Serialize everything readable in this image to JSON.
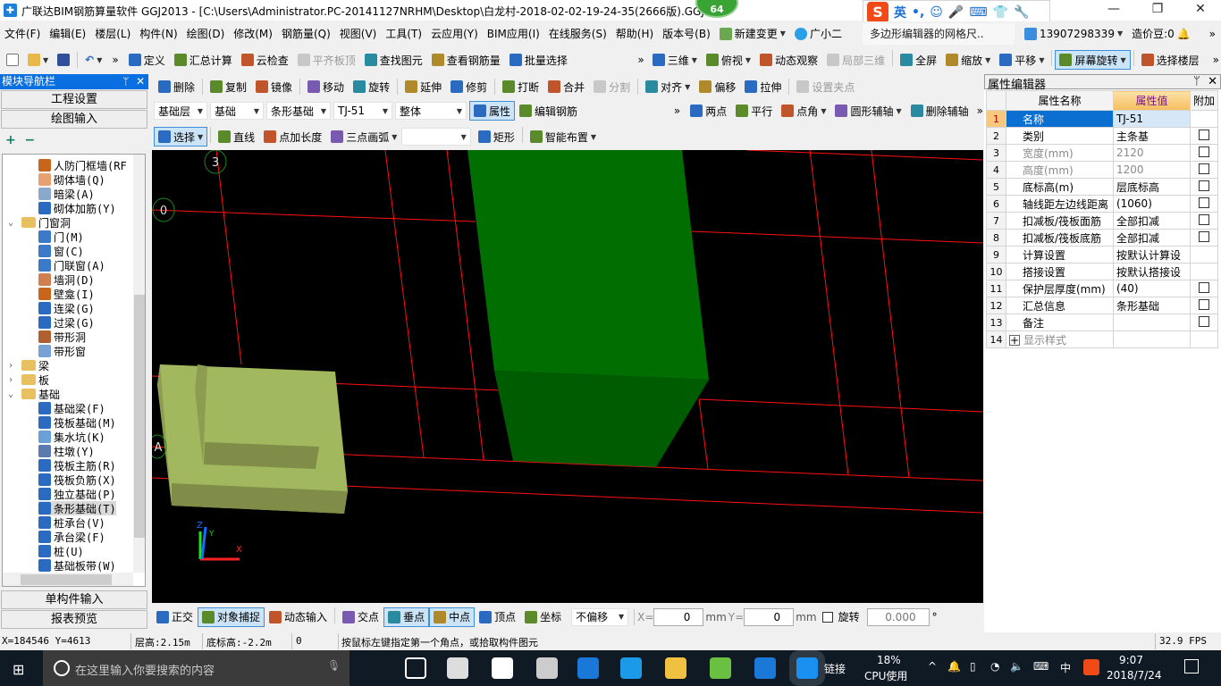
{
  "title_bar": {
    "title": "广联达BIM钢筋算量软件 GGJ2013 - [C:\\Users\\Administrator.PC-20141127NRHM\\Desktop\\白龙村-2018-02-02-19-24-35(2666版).GGJ12",
    "badge": "64",
    "minimize": "—",
    "restore": "❐",
    "close": "✕"
  },
  "ime": {
    "logo": "S",
    "lang": "英",
    "punct": "•,",
    "emoji": "☺",
    "mic": "🎤",
    "keyboard": "⌨",
    "skin": "👕",
    "settings": "🔧"
  },
  "menu": {
    "items": [
      "文件(F)",
      "编辑(E)",
      "楼层(L)",
      "构件(N)",
      "绘图(D)",
      "修改(M)",
      "钢筋量(Q)",
      "视图(V)",
      "工具(T)",
      "云应用(Y)",
      "BIM应用(I)",
      "在线服务(S)",
      "帮助(H)",
      "版本号(B)"
    ],
    "new_change": "新建变更",
    "assistant": "广小二",
    "notice": "多边形编辑器的网格尺..",
    "account": "13907298339",
    "beans": "造价豆:0",
    "more": "»"
  },
  "toolbar1": {
    "more": "»",
    "left": [
      {
        "label": "定义",
        "icon": "define-icon",
        "state": ""
      },
      {
        "label": "汇总计算",
        "icon": "sigma-icon",
        "state": ""
      },
      {
        "label": "云检查",
        "icon": "cloud-check-icon",
        "state": ""
      },
      {
        "label": "平齐板顶",
        "icon": "align-slab-top-icon",
        "state": "dis"
      },
      {
        "label": "查找图元",
        "icon": "binoculars-icon",
        "state": ""
      },
      {
        "label": "查看钢筋量",
        "icon": "view-rebar-icon",
        "state": ""
      },
      {
        "label": "批量选择",
        "icon": "batch-select-icon",
        "state": ""
      }
    ],
    "right": [
      {
        "label": "三维",
        "icon": "cube-3d-icon",
        "state": "",
        "dd": true
      },
      {
        "label": "俯视",
        "icon": "top-view-icon",
        "state": "",
        "dd": true
      },
      {
        "label": "动态观察",
        "icon": "orbit-icon",
        "state": ""
      },
      {
        "label": "局部三维",
        "icon": "local-3d-icon",
        "state": "dis"
      },
      {
        "label": "全屏",
        "icon": "fullscreen-icon",
        "state": ""
      },
      {
        "label": "缩放",
        "icon": "zoom-icon",
        "state": "",
        "dd": true
      },
      {
        "label": "平移",
        "icon": "pan-hand-icon",
        "state": "",
        "dd": true
      },
      {
        "label": "屏幕旋转",
        "icon": "screen-rotate-icon",
        "state": "act",
        "dd": true
      },
      {
        "label": "选择楼层",
        "icon": "select-floor-icon",
        "state": ""
      }
    ]
  },
  "toolbar2": [
    {
      "label": "删除",
      "icon": "delete-icon",
      "state": ""
    },
    {
      "label": "复制",
      "icon": "copy-icon",
      "state": ""
    },
    {
      "label": "镜像",
      "icon": "mirror-icon",
      "state": ""
    },
    {
      "label": "移动",
      "icon": "move-icon",
      "state": ""
    },
    {
      "label": "旋转",
      "icon": "rotate-icon",
      "state": ""
    },
    {
      "label": "延伸",
      "icon": "extend-icon",
      "state": ""
    },
    {
      "label": "修剪",
      "icon": "trim-icon",
      "state": ""
    },
    {
      "label": "打断",
      "icon": "break-icon",
      "state": ""
    },
    {
      "label": "合并",
      "icon": "merge-icon",
      "state": ""
    },
    {
      "label": "分割",
      "icon": "split-icon",
      "state": "dis"
    },
    {
      "label": "对齐",
      "icon": "align-icon",
      "state": "",
      "dd": true
    },
    {
      "label": "偏移",
      "icon": "offset-icon",
      "state": ""
    },
    {
      "label": "拉伸",
      "icon": "stretch-icon",
      "state": ""
    },
    {
      "label": "设置夹点",
      "icon": "grip-icon",
      "state": "dis"
    }
  ],
  "toolbar3": {
    "selects": [
      "基础层",
      "基础",
      "条形基础",
      "TJ-51",
      "整体"
    ],
    "buttons": [
      {
        "label": "属性",
        "icon": "properties-icon",
        "state": "act"
      },
      {
        "label": "编辑钢筋",
        "icon": "edit-rebar-icon",
        "state": ""
      }
    ],
    "more": "»",
    "axis": [
      {
        "label": "两点",
        "icon": "two-point-axis-icon",
        "state": ""
      },
      {
        "label": "平行",
        "icon": "parallel-axis-icon",
        "state": ""
      },
      {
        "label": "点角",
        "icon": "point-angle-axis-icon",
        "state": "",
        "dd": true
      },
      {
        "label": "圆形辅轴",
        "icon": "circular-axis-icon",
        "state": "",
        "dd": true
      },
      {
        "label": "删除辅轴",
        "icon": "delete-axis-icon",
        "state": ""
      }
    ]
  },
  "toolbar4": {
    "items": [
      {
        "label": "选择",
        "icon": "pointer-icon",
        "state": "act",
        "dd": true
      },
      {
        "label": "直线",
        "icon": "line-icon",
        "state": ""
      },
      {
        "label": "点加长度",
        "icon": "point-length-icon",
        "state": ""
      },
      {
        "label": "三点画弧",
        "icon": "arc-icon",
        "state": "",
        "dd": true
      }
    ],
    "shape_select": "",
    "items2": [
      {
        "label": "矩形",
        "icon": "rectangle-icon",
        "state": ""
      },
      {
        "label": "智能布置",
        "icon": "smart-layout-icon",
        "state": "",
        "dd": true
      }
    ]
  },
  "nav": {
    "title": "模块导航栏",
    "pin": "ᛘ",
    "close": "✕",
    "top_buttons": [
      "工程设置",
      "绘图输入"
    ],
    "expand_icon": "+",
    "collapse_icon": "−",
    "tree": [
      {
        "label": "人防门框墙(RF",
        "level": 2,
        "icon": "civil-defense-wall-icon",
        "color": "#c8651b"
      },
      {
        "label": "砌体墙(Q)",
        "level": 2,
        "icon": "masonry-wall-icon",
        "color": "#e8a070"
      },
      {
        "label": "暗梁(A)",
        "level": 2,
        "icon": "hidden-beam-icon",
        "color": "#8aa8cc"
      },
      {
        "label": "砌体加筋(Y)",
        "level": 2,
        "icon": "masonry-rebar-icon",
        "color": "#2a6ac0"
      },
      {
        "label": "门窗洞",
        "level": 1,
        "icon": "folder-open-icon",
        "color": "#e8c060",
        "expanded": true
      },
      {
        "label": "门(M)",
        "level": 2,
        "icon": "door-icon",
        "color": "#3a78c8"
      },
      {
        "label": "窗(C)",
        "level": 2,
        "icon": "window-icon",
        "color": "#3a78c8"
      },
      {
        "label": "门联窗(A)",
        "level": 2,
        "icon": "door-window-icon",
        "color": "#3a78c8"
      },
      {
        "label": "墙洞(D)",
        "level": 2,
        "icon": "wall-hole-icon",
        "color": "#d08050"
      },
      {
        "label": "壁龛(I)",
        "level": 2,
        "icon": "niche-icon",
        "color": "#c8651b"
      },
      {
        "label": "连梁(G)",
        "level": 2,
        "icon": "coupling-beam-icon",
        "color": "#2a6ac0"
      },
      {
        "label": "过梁(G)",
        "level": 2,
        "icon": "lintel-icon",
        "color": "#2a6ac0"
      },
      {
        "label": "带形洞",
        "level": 2,
        "icon": "strip-hole-icon",
        "color": "#b06030"
      },
      {
        "label": "带形窗",
        "level": 2,
        "icon": "strip-window-icon",
        "color": "#7aa0d8"
      },
      {
        "label": "梁",
        "level": 1,
        "icon": "folder-icon",
        "color": "#e8c060",
        "expanded": false
      },
      {
        "label": "板",
        "level": 1,
        "icon": "folder-icon",
        "color": "#e8c060",
        "expanded": false
      },
      {
        "label": "基础",
        "level": 1,
        "icon": "folder-open-icon",
        "color": "#e8c060",
        "expanded": true
      },
      {
        "label": "基础梁(F)",
        "level": 2,
        "icon": "foundation-beam-icon",
        "color": "#2a6ac0"
      },
      {
        "label": "筏板基础(M)",
        "level": 2,
        "icon": "raft-foundation-icon",
        "color": "#2a6ac0"
      },
      {
        "label": "集水坑(K)",
        "level": 2,
        "icon": "sump-pit-icon",
        "color": "#6aa0d8"
      },
      {
        "label": "柱墩(Y)",
        "level": 2,
        "icon": "column-pier-icon",
        "color": "#5a7ab0"
      },
      {
        "label": "筏板主筋(R)",
        "level": 2,
        "icon": "raft-main-rebar-icon",
        "color": "#2a6ac0"
      },
      {
        "label": "筏板负筋(X)",
        "level": 2,
        "icon": "raft-neg-rebar-icon",
        "color": "#2a6ac0"
      },
      {
        "label": "独立基础(P)",
        "level": 2,
        "icon": "isolated-foundation-icon",
        "color": "#2a6ac0"
      },
      {
        "label": "条形基础(T)",
        "level": 2,
        "icon": "strip-foundation-icon",
        "color": "#2a6ac0",
        "selected": true
      },
      {
        "label": "桩承台(V)",
        "level": 2,
        "icon": "pile-cap-icon",
        "color": "#2a6ac0"
      },
      {
        "label": "承台梁(F)",
        "level": 2,
        "icon": "cap-beam-icon",
        "color": "#2a6ac0"
      },
      {
        "label": "桩(U)",
        "level": 2,
        "icon": "pile-icon",
        "color": "#2a6ac0"
      },
      {
        "label": "基础板带(W)",
        "level": 2,
        "icon": "foundation-strip-icon",
        "color": "#2a6ac0"
      }
    ],
    "bottom_buttons": [
      "单构件输入",
      "报表预览"
    ]
  },
  "viewport": {
    "axis_labels": [
      "3",
      "0",
      "A"
    ],
    "gizmo": {
      "x": "X",
      "y": "Y",
      "z": "Z"
    },
    "colors": {
      "grid": "#ff0000",
      "column_front": "#006e00",
      "column_bottom": "#005c00",
      "footing_top": "#a1b85e",
      "footing_side": "#7f8d48"
    }
  },
  "snap_toolbar": {
    "items": [
      {
        "label": "正交",
        "icon": "ortho-icon",
        "state": ""
      },
      {
        "label": "对象捕捉",
        "icon": "object-snap-icon",
        "state": "act"
      },
      {
        "label": "动态输入",
        "icon": "dynamic-input-icon",
        "state": ""
      },
      {
        "label": "交点",
        "icon": "intersection-icon",
        "state": ""
      },
      {
        "label": "垂点",
        "icon": "perpendicular-icon",
        "state": "act"
      },
      {
        "label": "中点",
        "icon": "midpoint-icon",
        "state": "act"
      },
      {
        "label": "顶点",
        "icon": "vertex-icon",
        "state": ""
      },
      {
        "label": "坐标",
        "icon": "coordinate-icon",
        "state": ""
      }
    ],
    "offset": "不偏移",
    "x_label": "X=",
    "x_value": "0",
    "unit": "mm",
    "y_label": "Y=",
    "y_value": "0",
    "rotate_label": "旋转",
    "rotate_value": "0.000",
    "degree": "°"
  },
  "status": {
    "coords": "X=184546 Y=4613",
    "floor_height": "层高:2.15m",
    "bottom_elev": "底标高:-2.2m",
    "value": "0",
    "message": "按鼠标左键指定第一个角点，或拾取构件图元",
    "fps": "32.9 FPS"
  },
  "properties": {
    "title": "属性编辑器",
    "pin": "ᛘ",
    "close": "✕",
    "headers": [
      "属性名称",
      "属性值",
      "附加"
    ],
    "rows": [
      {
        "num": "1",
        "name": "名称",
        "value": "TJ-51",
        "check": null,
        "current": true
      },
      {
        "num": "2",
        "name": "类别",
        "value": "主条基",
        "check": false
      },
      {
        "num": "3",
        "name": "宽度(mm)",
        "value": "2120",
        "check": false,
        "grey": true
      },
      {
        "num": "4",
        "name": "高度(mm)",
        "value": "1200",
        "check": false,
        "grey": true
      },
      {
        "num": "5",
        "name": "底标高(m)",
        "value": "层底标高",
        "check": false
      },
      {
        "num": "6",
        "name": "轴线距左边线距离",
        "value": "(1060)",
        "check": false
      },
      {
        "num": "7",
        "name": "扣减板/筏板面筋",
        "value": "全部扣减",
        "check": false
      },
      {
        "num": "8",
        "name": "扣减板/筏板底筋",
        "value": "全部扣减",
        "check": false
      },
      {
        "num": "9",
        "name": "计算设置",
        "value": "按默认计算设",
        "check": null
      },
      {
        "num": "10",
        "name": "搭接设置",
        "value": "按默认搭接设",
        "check": null
      },
      {
        "num": "11",
        "name": "保护层厚度(mm)",
        "value": "(40)",
        "check": false
      },
      {
        "num": "12",
        "name": "汇总信息",
        "value": "条形基础",
        "check": false
      },
      {
        "num": "13",
        "name": "备注",
        "value": "",
        "check": false
      },
      {
        "num": "14",
        "name": "显示样式",
        "value": "",
        "check": null,
        "grey": true,
        "expander": "+"
      }
    ]
  },
  "taskbar": {
    "search_placeholder": "在这里输入你要搜索的内容",
    "apps": [
      "task-view",
      "fan-app",
      "ie-app",
      "sogou-browser",
      "edge-app",
      "ie-app-2",
      "file-explorer",
      "360-browser",
      "glodon-app",
      "glodon-ggj-app"
    ],
    "link": "链接",
    "cpu_percent": "18%",
    "cpu_label": "CPU使用",
    "ime_mode": "中",
    "time": "9:07",
    "date": "2018/7/24"
  }
}
